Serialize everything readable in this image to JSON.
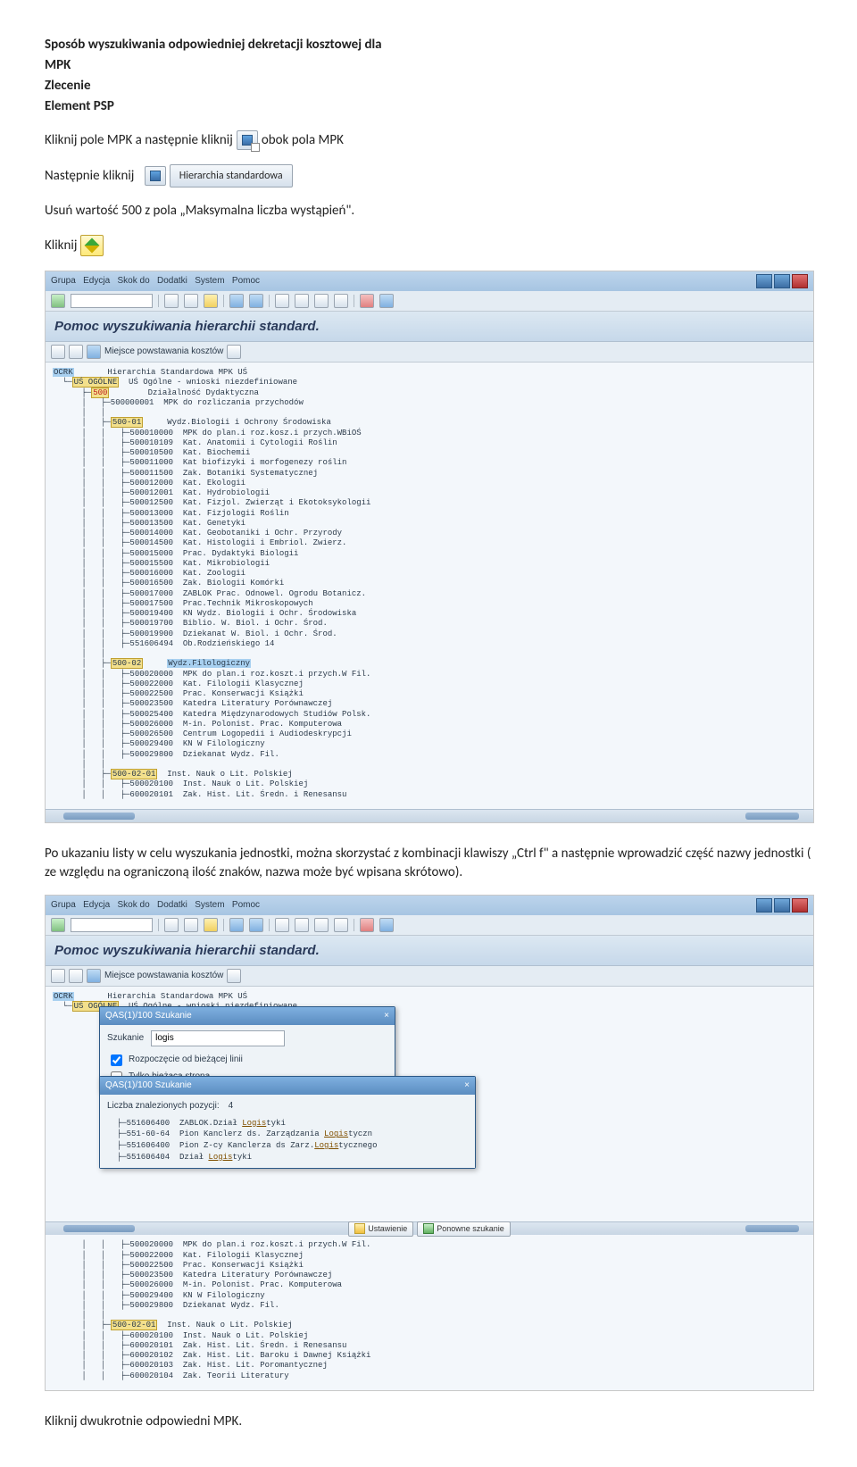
{
  "doc": {
    "heading_line1": "Sposób wyszukiwania odpowiedniej dekretacji kosztowej dla",
    "heading_line2": "MPK",
    "heading_line3": "Zlecenie",
    "heading_line4": "Element PSP",
    "row1a": "Kliknij pole MPK a następnie kliknij",
    "row1b": "obok pola MPK",
    "row2a": "Następnie kliknij",
    "hier_btn": "Hierarchia standardowa",
    "line3": "Usuń wartość 500 z pola „Maksymalna liczba wystąpień\".",
    "line4": "Kliknij",
    "para2": "Po ukazaniu listy w celu wyszukania jednostki, można skorzystać z kombinacji klawiszy „Ctrl f\" a następnie wprowadzić część nazwy jednostki ( ze względu na ograniczoną ilość znaków, nazwa może być wpisana skrótowo).",
    "last": "Kliknij dwukrotnie odpowiedni MPK."
  },
  "shot1": {
    "menu": [
      "Grupa",
      "Edycja",
      "Skok do",
      "Dodatki",
      "System",
      "Pomoc"
    ],
    "header": "Pomoc wyszukiwania hierarchii standard.",
    "sub_label": "Miejsce powstawania kosztów",
    "root_code": "OCRK",
    "root_text": "Hierarchia Standardowa MPK UŚ",
    "l1_code": "UŚ OGÓLNE",
    "l1_text": "UŚ Ogólne - wnioski niezdefiniowane",
    "l2_code": "500",
    "l2_text": "Działalność Dydaktyczna",
    "l3a_code": "500000001",
    "l3a_text": "MPK do rozliczania przychodów",
    "l3b_code": "500-01",
    "l3b_text": "Wydz.Biologii i Ochrony Środowiska",
    "wbios": [
      [
        "500010000",
        "MPK do plan.i roz.kosz.i przych.WBiOŚ"
      ],
      [
        "500010109",
        "Kat. Anatomii i Cytologii Roślin"
      ],
      [
        "500010500",
        "Kat. Biochemii"
      ],
      [
        "500011000",
        "Kat biofizyki i morfogenezy roślin"
      ],
      [
        "500011500",
        "Zak. Botaniki Systematycznej"
      ],
      [
        "500012000",
        "Kat. Ekologii"
      ],
      [
        "500012001",
        "Kat. Hydrobiologii"
      ],
      [
        "500012500",
        "Kat. Fizjol. Zwierząt i Ekotoksykologii"
      ],
      [
        "500013000",
        "Kat. Fizjologii Roślin"
      ],
      [
        "500013500",
        "Kat. Genetyki"
      ],
      [
        "500014000",
        "Kat. Geobotaniki i Ochr. Przyrody"
      ],
      [
        "500014500",
        "Kat. Histologii i Embriol. Zwierz."
      ],
      [
        "500015000",
        "Prac. Dydaktyki Biologii"
      ],
      [
        "500015500",
        "Kat. Mikrobiologii"
      ],
      [
        "500016000",
        "Kat. Zoologii"
      ],
      [
        "500016500",
        "Zak. Biologii Komórki"
      ],
      [
        "500017000",
        "ZABLOK Prac. Odnowel. Ogrodu Botanicz."
      ],
      [
        "500017500",
        "Prac.Technik Mikroskopowych"
      ],
      [
        "500019400",
        "KN Wydz. Biologii i Ochr. Środowiska"
      ],
      [
        "500019700",
        "Biblio. W. Biol. i Ochr. Środ."
      ],
      [
        "500019900",
        "Dziekanat W. Biol. i Ochr. Środ."
      ],
      [
        "551606494",
        "Ob.Rodzieńskiego 14"
      ]
    ],
    "l3c_code": "500-02",
    "l3c_text": "Wydz.Filologiczny",
    "fil": [
      [
        "500020000",
        "MPK do plan.i roz.koszt.i przych.W Fil."
      ],
      [
        "500022000",
        "Kat. Filologii Klasycznej"
      ],
      [
        "500022500",
        "Prac. Konserwacji Książki"
      ],
      [
        "500023500",
        "Katedra Literatury Porównawczej"
      ],
      [
        "500025400",
        "Katedra Międzynarodowych Studiów Polsk."
      ],
      [
        "500026000",
        "M-in. Polonist. Prac. Komputerowa"
      ],
      [
        "500026500",
        "Centrum Logopedii i Audiodeskrypcji"
      ],
      [
        "500029400",
        "KN W Filologiczny"
      ],
      [
        "500029800",
        "Dziekanat Wydz. Fil."
      ]
    ],
    "l4_code": "500-02-01",
    "l4_text": "Inst. Nauk o Lit. Polskiej",
    "l4_children": [
      [
        "500020100",
        "Inst. Nauk o Lit. Polskiej"
      ],
      [
        "600020101",
        "Zak. Hist. Lit. Średn. i Renesansu"
      ]
    ]
  },
  "shot2": {
    "menu": [
      "Grupa",
      "Edycja",
      "Skok do",
      "Dodatki",
      "System",
      "Pomoc"
    ],
    "header": "Pomoc wyszukiwania hierarchii standard.",
    "sub_label": "Miejsce powstawania kosztów",
    "root_code": "OCRK",
    "root_text": "Hierarchia Standardowa MPK UŚ",
    "l1_code": "UŚ OGÓLNE",
    "l1_text": "UŚ Ogólne - wnioski niezdefiniowane",
    "box1_title": "QAS(1)/100 Szukanie",
    "box1_search_label": "Szukanie",
    "box1_search_value": "logis",
    "box1_chk1": "Rozpoczęcie od bieżącej linii",
    "box1_chk2": "Tylko bieżąca strona",
    "box2_title": "QAS(1)/100 Szukanie",
    "box2_found_label": "Liczba znalezionych pozycji:",
    "box2_found_value": "4",
    "box2_results": [
      [
        "551606400",
        "ZABLOK.Dział Logistyki"
      ],
      [
        "551-60-64",
        "Pion Kanclerz ds. Zarządzania Logistyczn"
      ],
      [
        "551606400",
        "Pion Z-cy Kanclerza ds Zarz.Logistycznego"
      ],
      [
        "551606404",
        "Dział Logistyki"
      ]
    ],
    "btn_set": "Ustawienie",
    "btn_search": "Ponowne szukanie",
    "fil": [
      [
        "500020000",
        "MPK do plan.i roz.koszt.i przych.W Fil."
      ],
      [
        "500022000",
        "Kat. Filologii Klasycznej"
      ],
      [
        "500022500",
        "Prac. Konserwacji Książki"
      ],
      [
        "500023500",
        "Katedra Literatury Porównawczej"
      ],
      [
        "500026000",
        "M-in. Polonist. Prac. Komputerowa"
      ],
      [
        "500029400",
        "KN W Filologiczny"
      ],
      [
        "500029800",
        "Dziekanat Wydz. Fil."
      ]
    ],
    "l4_code": "500-02-01",
    "l4_text": "Inst. Nauk o Lit. Polskiej",
    "l4_children": [
      [
        "600020100",
        "Inst. Nauk o Lit. Polskiej"
      ],
      [
        "600020101",
        "Zak. Hist. Lit. Średn. i Renesansu"
      ],
      [
        "600020102",
        "Zak. Hist. Lit. Baroku i Dawnej Książki"
      ],
      [
        "600020103",
        "Zak. Hist. Lit. Poromantycznej"
      ],
      [
        "600020104",
        "Zak. Teorii Literatury"
      ]
    ]
  }
}
